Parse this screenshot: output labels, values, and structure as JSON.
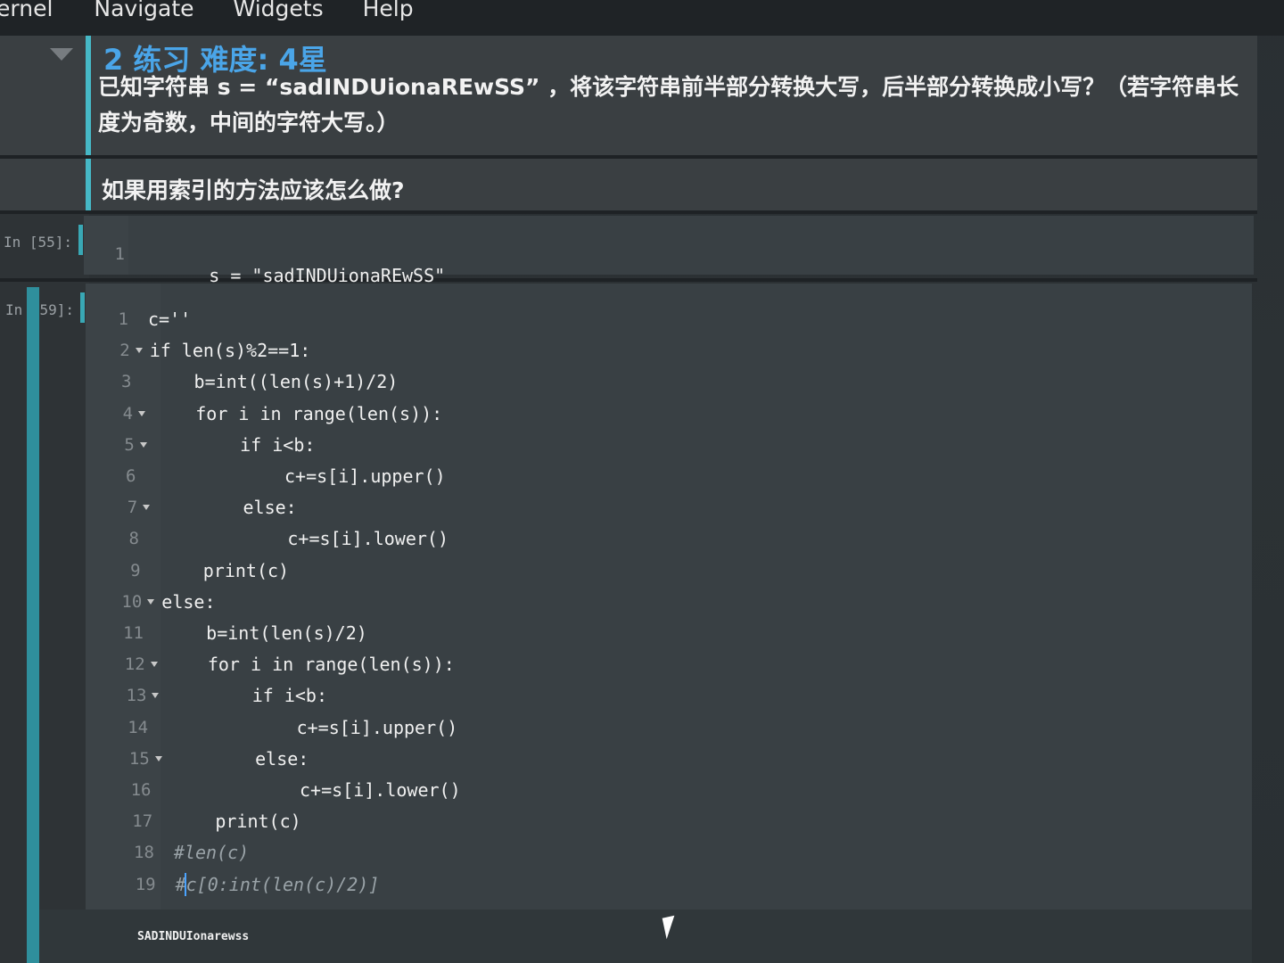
{
  "menu": {
    "items": [
      "ernel",
      "Navigate",
      "Widgets",
      "Help"
    ]
  },
  "markdown_cell_1": {
    "heading": "2  练习 难度: 4星",
    "paragraph": "已知字符串 s = “sadINDUionaREwSS” ，将该字符串前半部分转换大写，后半部分转换成小写？（若字符串长度为奇数，中间的字符大写。）"
  },
  "markdown_cell_2": {
    "text": "如果用索引的方法应该怎么做?"
  },
  "code_cell_1": {
    "prompt": "In  [55]:",
    "lines": [
      {
        "number": "1",
        "code": "s = \"sadINDUionaREwSS\""
      }
    ]
  },
  "code_cell_2": {
    "prompt": "In  [59]:",
    "lines": [
      {
        "number": "1",
        "code": "c=''"
      },
      {
        "number": "2",
        "code": "if len(s)%2==1:"
      },
      {
        "number": "3",
        "code": "    b=int((len(s)+1)/2)"
      },
      {
        "number": "4",
        "code": "    for i in range(len(s)):"
      },
      {
        "number": "5",
        "code": "        if i<b:"
      },
      {
        "number": "6",
        "code": "            c+=s[i].upper()"
      },
      {
        "number": "7",
        "code": "        else:"
      },
      {
        "number": "8",
        "code": "            c+=s[i].lower()"
      },
      {
        "number": "9",
        "code": "    print(c)"
      },
      {
        "number": "10",
        "code": "else:"
      },
      {
        "number": "11",
        "code": "    b=int(len(s)/2)"
      },
      {
        "number": "12",
        "code": "    for i in range(len(s)):"
      },
      {
        "number": "13",
        "code": "        if i<b:"
      },
      {
        "number": "14",
        "code": "            c+=s[i].upper()"
      },
      {
        "number": "15",
        "code": "        else:"
      },
      {
        "number": "16",
        "code": "            c+=s[i].lower()"
      },
      {
        "number": "17",
        "code": "    print(c)"
      },
      {
        "number": "18",
        "code": "#len(c)"
      },
      {
        "number": "19",
        "code": "#c[0:int(len(c)/2)]"
      }
    ],
    "output": "SADINDUIonarewss"
  },
  "colors": {
    "accent_bar": "#46b8c6",
    "heading": "#4aa5e8",
    "builtin": "#f2a45a"
  }
}
